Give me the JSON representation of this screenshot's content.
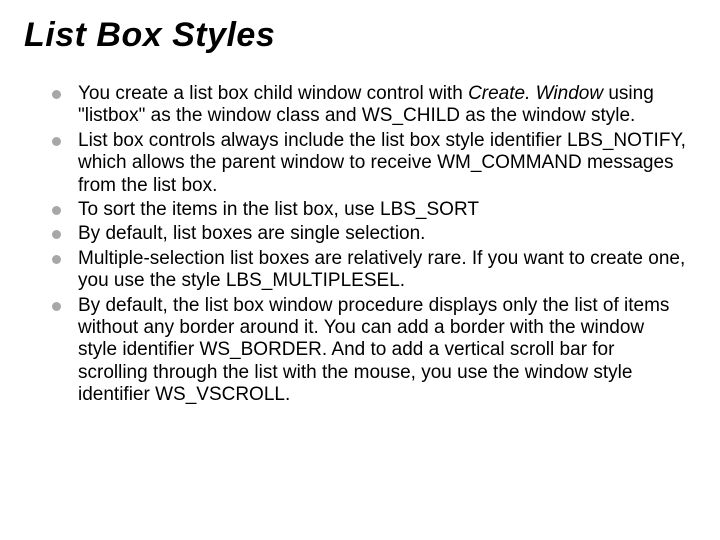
{
  "title": "List Box Styles",
  "bullets": [
    {
      "pre": "You create a list box child window control with ",
      "em": "Create. Window",
      "post": " using \"listbox\" as the window class and WS_CHILD as the window style."
    },
    {
      "pre": "List box controls always include the list box style identifier LBS_NOTIFY, which allows the parent window to receive WM_COMMAND messages from the list box.",
      "em": "",
      "post": ""
    },
    {
      "pre": "To sort the items in the list box, use LBS_SORT",
      "em": "",
      "post": ""
    },
    {
      "pre": "By default, list boxes are single selection.",
      "em": "",
      "post": ""
    },
    {
      "pre": "Multiple-selection list boxes are relatively rare. If you want to create one, you use the style LBS_MULTIPLESEL.",
      "em": "",
      "post": ""
    },
    {
      "pre": "By default, the list box window procedure displays only the list of items without any border around it. You can add a border with the window style identifier WS_BORDER. And to add a vertical scroll bar for scrolling through the list with the mouse, you use the window style identifier WS_VSCROLL.",
      "em": "",
      "post": ""
    }
  ]
}
